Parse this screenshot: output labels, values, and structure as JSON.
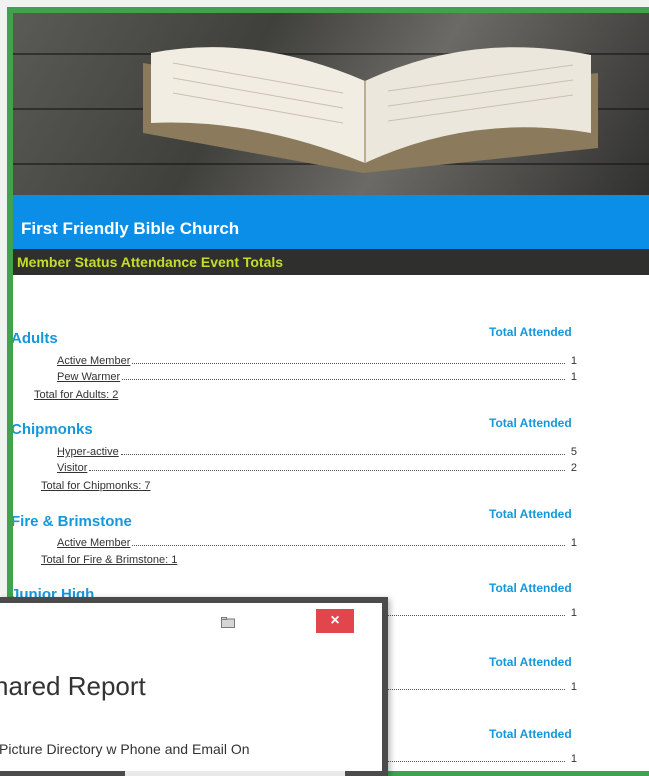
{
  "report": {
    "church_name": "First Friendly Bible Church",
    "report_title": "Member Status Attendance Event Totals",
    "column_header": "Total Attended",
    "groups": [
      {
        "name": "Adults",
        "rows": [
          {
            "label": "Active Member",
            "count": "1"
          },
          {
            "label": "Pew Warmer",
            "count": "1"
          }
        ],
        "total": "Total for Adults: 2"
      },
      {
        "name": "Chipmonks",
        "rows": [
          {
            "label": "Hyper-active",
            "count": "5"
          },
          {
            "label": "Visitor",
            "count": "2"
          }
        ],
        "total": "Total for Chipmonks: 7"
      },
      {
        "name": "Fire & Brimstone",
        "rows": [
          {
            "label": "Active Member",
            "count": "1"
          }
        ],
        "total": "Total for Fire & Brimstone: 1"
      },
      {
        "name": "Junior High",
        "rows": [
          {
            "label": "",
            "count": "1"
          }
        ],
        "total": ""
      },
      {
        "name": "",
        "rows": [
          {
            "label": "",
            "count": "1"
          }
        ],
        "total": ""
      },
      {
        "name": "",
        "rows": [
          {
            "label": "",
            "count": "1"
          }
        ],
        "total": ""
      }
    ]
  },
  "dialog": {
    "title": "hared Report",
    "body": "Picture Directory w Phone and Email On",
    "close_label": "×",
    "icon": "folder-icon"
  }
}
